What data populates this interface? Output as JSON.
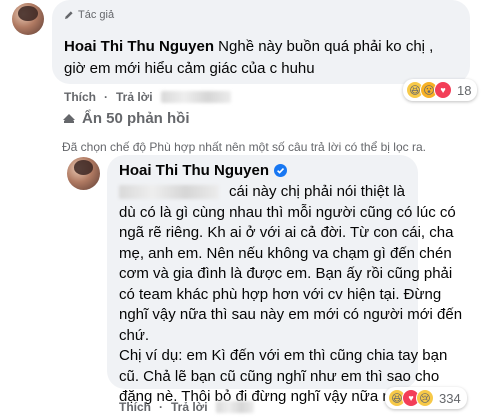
{
  "comment1": {
    "author_badge": "Tác giả",
    "author": "Hoai Thi Thu Nguyen",
    "text_line1": "Nghề này buồn quá phải ko chị ,",
    "text_line2": "giờ em mới hiểu cảm giác của c huhu",
    "like_label": "Thích",
    "reply_label": "Trả lời",
    "reaction_count": "18"
  },
  "replies": {
    "toggle_label": "Ẩn 50 phản hồi",
    "notice": "Đã chọn chế độ Phù hợp nhất nên một số câu trả lời có thể bị lọc ra."
  },
  "comment2": {
    "author": "Hoai Thi Thu Nguyen",
    "lines": [
      "cái này chị phải nói thiệt là",
      "dù có là gì cùng nhau thì mỗi người cũng có lúc có",
      "ngã rẽ riêng. Kh ai ở với ai cả đời. Từ con cái, cha",
      "mẹ, anh em. Nên nếu không va chạm gì đến chén",
      "cơm và gia đình là được em. Bạn ấy rồi cũng phải",
      "có team khác phù hợp hơn với cv hiện tại. Đừng",
      "nghĩ vậy nữa thì sau này em mới có người mới đến",
      "chứ.",
      "Chị ví dụ: em Kì đến với em thì cũng chia tay bạn",
      "cũ. Chả lẽ bạn cũ cũng nghĩ như em thì sao cho",
      "đặng nè. Thôi bỏ đi đừng nghĩ vậy nữa nhen."
    ],
    "like_label": "Thích",
    "reply_label": "Trả lời",
    "reaction_count": "334"
  },
  "colors": {
    "bubble": "#f0f2f5",
    "meta_text": "#65676b",
    "verified": "#1877f2",
    "love": "#f33e58",
    "haha": "#f7c948"
  },
  "icons": [
    "pencil-icon",
    "chevron-up-icon",
    "verified-badge-icon",
    "haha-reaction-icon",
    "wow-reaction-icon",
    "love-reaction-icon",
    "sad-reaction-icon"
  ]
}
